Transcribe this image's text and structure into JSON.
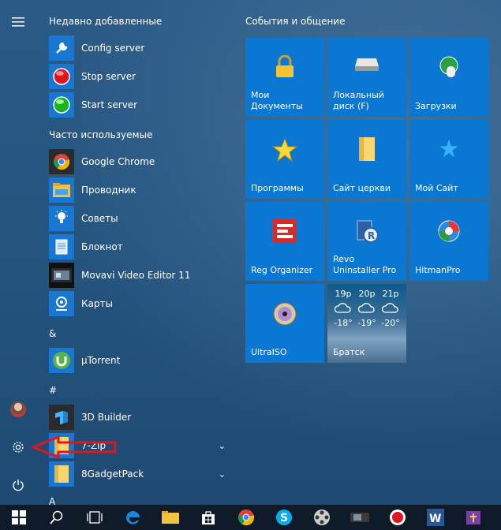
{
  "sections": {
    "recent": "Недавно добавленные",
    "frequent": "Часто используемые",
    "amp": "&",
    "hash": "#",
    "a": "A"
  },
  "apps": {
    "config_server": "Config server",
    "stop_server": "Stop server",
    "start_server": "Start server",
    "chrome": "Google Chrome",
    "explorer": "Проводник",
    "tips": "Советы",
    "notepad": "Блокнот",
    "movavi": "Movavi Video Editor 11",
    "maps": "Карты",
    "utorrent": "µTorrent",
    "builder3d": "3D Builder",
    "zip7": "7-Zip",
    "gadgetpack": "8GadgetPack"
  },
  "tiles": {
    "group_title": "События и общение",
    "docs_line1": "Мои",
    "docs_line2": "Документы",
    "disk_line1": "Локальный",
    "disk_line2": "диск (F)",
    "downloads": "Загрузки",
    "programs": "Программы",
    "church": "Сайт церкви",
    "mysite": "Мой Сайт",
    "reg": "Reg Organizer",
    "revo_line1": "Revo",
    "revo_line2": "Uninstaller Pro",
    "hitman": "HitmanPro",
    "ultraiso": "UltraISO",
    "weather_city": "Братск",
    "weather_times": [
      "19р",
      "20р",
      "21р"
    ],
    "weather_temps": [
      "-18°",
      "-19°",
      "-20°"
    ]
  },
  "colors": {
    "tile_blue": "#0a78d2",
    "taskbar": "#0f1b28",
    "arrow_red": "#e0161c"
  }
}
